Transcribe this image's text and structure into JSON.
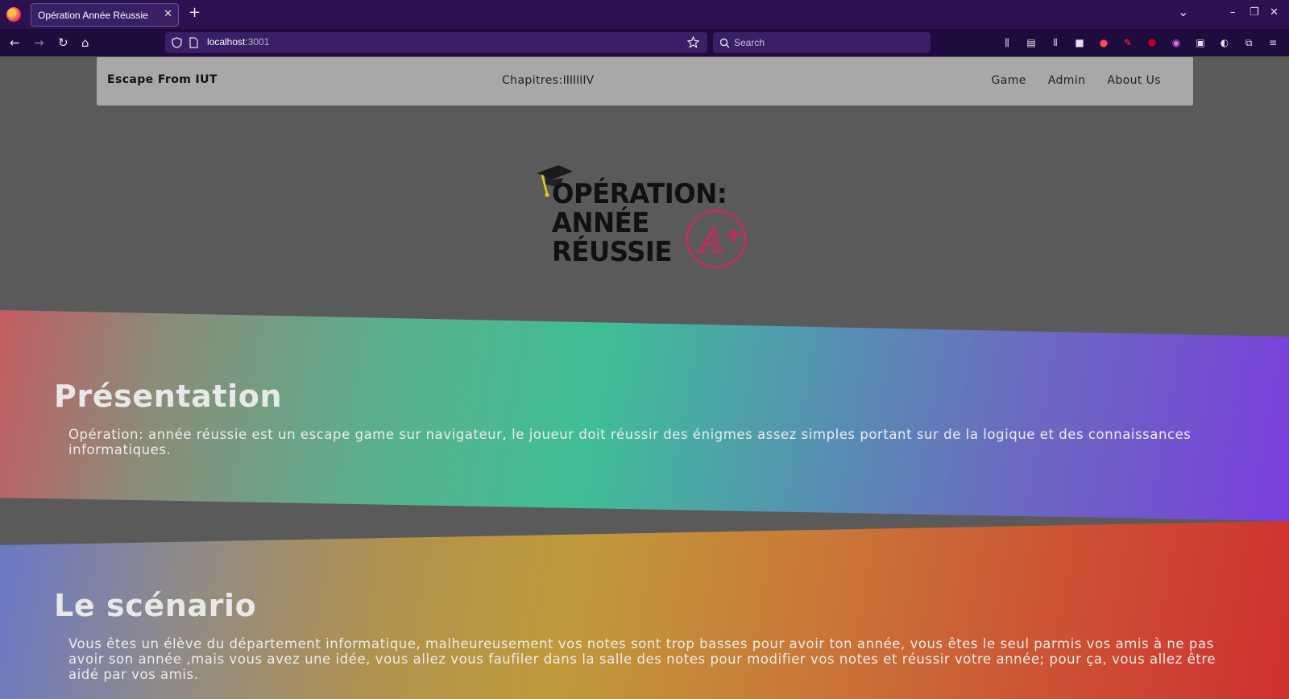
{
  "browser": {
    "tab_title": "Opération Année Réussie",
    "tab_close": "✕",
    "new_tab": "+",
    "url_host": "localhost",
    "url_port": ":3001",
    "search_placeholder": "Search",
    "controls": {
      "list_all_tabs": "⌄",
      "minimize": "–",
      "restore": "❐",
      "close": "✕"
    },
    "nav": {
      "back": "←",
      "forward": "→",
      "reload": "↻",
      "home": "⌂"
    }
  },
  "site": {
    "brand": "Escape From IUT",
    "chapters_label": "Chapitres:",
    "chapters": [
      "I",
      "II",
      "III",
      "IV"
    ],
    "links": [
      "Game",
      "Admin",
      "About Us"
    ]
  },
  "logo": {
    "line1": "OPÉRATION:",
    "line2": "ANNÉE",
    "line3": "RÉUSSIE",
    "badge": "A⁺"
  },
  "sections": [
    {
      "title": "Présentation",
      "text": "Opération: année réussie est un escape game sur navigateur, le joueur doit réussir des énigmes assez simples portant sur de la logique et des connaissances informatiques."
    },
    {
      "title": "Le scénario",
      "text": "Vous êtes un élève du département informatique, malheureusement vos notes sont trop basses pour avoir ton année, vous êtes le seul parmis vos amis à ne pas avoir son année ,mais vous avez une idée, vous allez vous faufiler dans la salle des notes pour modifier vos notes et réussir votre année; pour ça, vous allez être aidé par vos amis."
    }
  ],
  "colors": {
    "browser_tabbar": "#2b1150",
    "browser_toolbar": "#1f0b3d",
    "page_bg": "#5a5a5a",
    "nav_bg": "#a8a8a8",
    "badge_red": "#d8245c"
  }
}
